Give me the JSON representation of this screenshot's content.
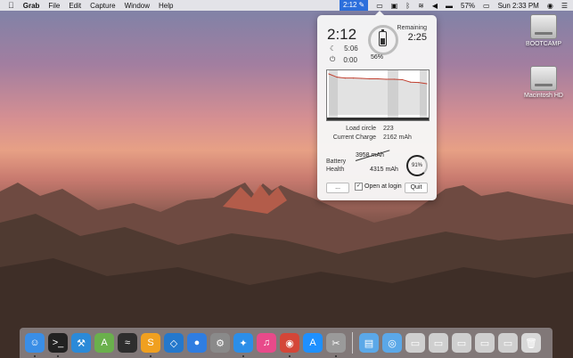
{
  "menubar": {
    "app_name": "Grab",
    "menus": [
      "File",
      "Edit",
      "Capture",
      "Window",
      "Help"
    ],
    "status_time": "2:12",
    "battery_percent": "57%",
    "datetime": "Sun 2:33 PM"
  },
  "desktop": {
    "icons": [
      {
        "label": "BOOTCAMP"
      },
      {
        "label": "Macintosh HD"
      }
    ]
  },
  "popover": {
    "elapsed_time": "2:12",
    "sleep_time": "5:06",
    "off_time": "0:00",
    "battery_percent_text": "56%",
    "battery_level": 0.56,
    "remaining_label": "Remaining",
    "remaining_value": "2:25",
    "load_cycle_label": "Load circle",
    "load_cycle_value": "223",
    "current_charge_label": "Current Charge",
    "current_charge_value": "2162 mAh",
    "health_label_line1": "Battery",
    "health_label_line2": "Health",
    "health_current": "3958 mAh",
    "health_design": "4315 mAh",
    "health_percent": "91%",
    "more_button": "...",
    "open_at_login_label": "Open at login",
    "open_at_login_checked": true,
    "quit_button": "Quit"
  },
  "chart_data": {
    "type": "area",
    "x": [
      0,
      1,
      2,
      3,
      4,
      5,
      6,
      7,
      8,
      9,
      10,
      11,
      12
    ],
    "values": [
      100,
      92,
      90,
      90,
      89,
      88,
      88,
      87,
      87,
      86,
      80,
      79,
      76
    ],
    "ylim": [
      0,
      100
    ],
    "series_color": "#e2e2e2"
  },
  "dock": {
    "items": [
      {
        "name": "finder-icon",
        "glyph": "☺",
        "color": "#3a8ee6",
        "running": true
      },
      {
        "name": "terminal-icon",
        "glyph": ">_",
        "color": "#222222",
        "running": true
      },
      {
        "name": "xcode-icon",
        "glyph": "⚒",
        "color": "#2b8ad8",
        "running": false
      },
      {
        "name": "android-studio-icon",
        "glyph": "A",
        "color": "#6ab04c",
        "running": false
      },
      {
        "name": "activity-monitor-icon",
        "glyph": "≈",
        "color": "#2e2e2e",
        "running": false
      },
      {
        "name": "sublime-text-icon",
        "glyph": "S",
        "color": "#f0a020",
        "running": true
      },
      {
        "name": "vscode-icon",
        "glyph": "◇",
        "color": "#2478cc",
        "running": false
      },
      {
        "name": "maps-pin-icon",
        "glyph": "●",
        "color": "#2f7de1",
        "running": false
      },
      {
        "name": "system-preferences-icon",
        "glyph": "⚙",
        "color": "#8a8a8a",
        "running": false
      },
      {
        "name": "safari-icon",
        "glyph": "✦",
        "color": "#2c8ee8",
        "running": true
      },
      {
        "name": "itunes-icon",
        "glyph": "♫",
        "color": "#e84a8a",
        "running": false
      },
      {
        "name": "chrome-icon",
        "glyph": "◉",
        "color": "#d44638",
        "running": true
      },
      {
        "name": "app-store-icon",
        "glyph": "A",
        "color": "#1e90ff",
        "running": false
      },
      {
        "name": "grab-icon",
        "glyph": "✂",
        "color": "#9a9a9a",
        "running": true
      },
      {
        "name": "separator",
        "glyph": "",
        "color": "",
        "running": false
      },
      {
        "name": "applications-folder-icon",
        "glyph": "▤",
        "color": "#5ba8e8",
        "running": false
      },
      {
        "name": "downloads-folder-icon",
        "glyph": "◎",
        "color": "#5ba8e8",
        "running": false
      },
      {
        "name": "screenshot-file-icon",
        "glyph": "▭",
        "color": "#cfcfcf",
        "running": false
      },
      {
        "name": "screenshot-file-icon",
        "glyph": "▭",
        "color": "#cfcfcf",
        "running": false
      },
      {
        "name": "screenshot-file-icon",
        "glyph": "▭",
        "color": "#cfcfcf",
        "running": false
      },
      {
        "name": "screenshot-file-icon",
        "glyph": "▭",
        "color": "#cfcfcf",
        "running": false
      },
      {
        "name": "screenshot-file-icon",
        "glyph": "▭",
        "color": "#cfcfcf",
        "running": false
      },
      {
        "name": "trash-icon",
        "glyph": "🗑",
        "color": "#d8d8d8",
        "running": false
      }
    ]
  }
}
